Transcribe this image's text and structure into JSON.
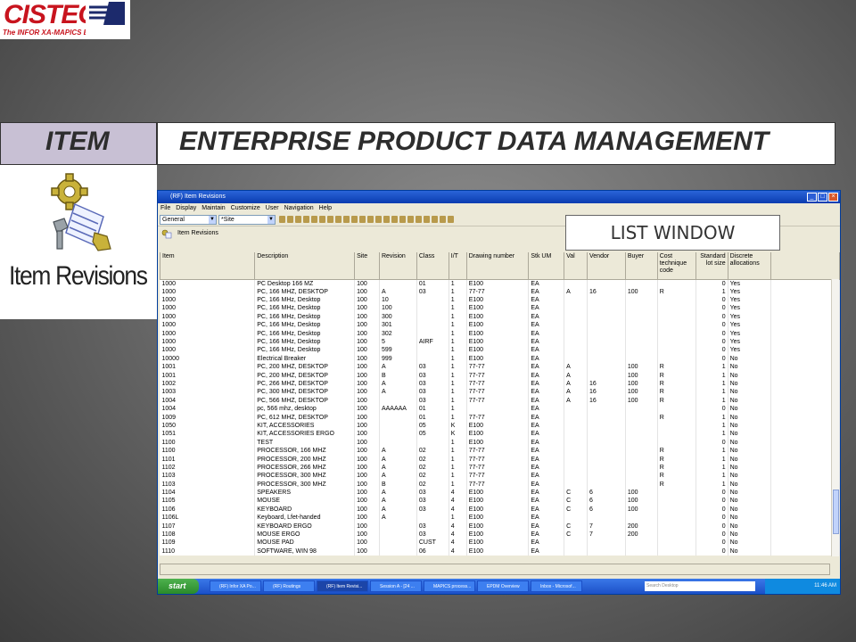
{
  "logo": {
    "word": "CISTECH",
    "tagline": "The INFOR XA-MAPICS Experts"
  },
  "banner": {
    "left": "ITEM",
    "right": "ENTERPRISE PRODUCT DATA MANAGEMENT"
  },
  "icon_panel": {
    "caption": "Item Revisions"
  },
  "callout": "LIST WINDOW",
  "window": {
    "title": "(RF) Item Revisions",
    "menu": [
      "File",
      "Display",
      "Maintain",
      "Customize",
      "User",
      "Navigation",
      "Help"
    ],
    "view_combo": "General",
    "site_combo": "*Site",
    "subheader": "Item Revisions"
  },
  "grid": {
    "columns": [
      "Item",
      "Description",
      "Site",
      "Revision",
      "Class",
      "I/T",
      "Drawing number",
      "Stk UM",
      "Val",
      "Vendor",
      "Buyer",
      "Cost technique code",
      "Standard lot size",
      "Discrete allocations"
    ],
    "rows": [
      [
        "1000",
        "PC Desktop 166 MZ",
        "100",
        "",
        "01",
        "1",
        "E100",
        "EA",
        "",
        "",
        "",
        "",
        "0",
        "Yes"
      ],
      [
        "1000",
        "PC, 166 MHZ, DESKTOP",
        "100",
        "A",
        "03",
        "1",
        "77-77",
        "EA",
        "A",
        "16",
        "100",
        "R",
        "1",
        "Yes"
      ],
      [
        "1000",
        "PC, 166 MHz, Desktop",
        "100",
        "10",
        "",
        "1",
        "E100",
        "EA",
        "",
        "",
        "",
        "",
        "0",
        "Yes"
      ],
      [
        "1000",
        "PC, 166 MHz, Desktop",
        "100",
        "100",
        "",
        "1",
        "E100",
        "EA",
        "",
        "",
        "",
        "",
        "0",
        "Yes"
      ],
      [
        "1000",
        "PC, 166 MHz, Desktop",
        "100",
        "300",
        "",
        "1",
        "E100",
        "EA",
        "",
        "",
        "",
        "",
        "0",
        "Yes"
      ],
      [
        "1000",
        "PC, 166 MHz, Desktop",
        "100",
        "301",
        "",
        "1",
        "E100",
        "EA",
        "",
        "",
        "",
        "",
        "0",
        "Yes"
      ],
      [
        "1000",
        "PC, 166 MHz, Desktop",
        "100",
        "302",
        "",
        "1",
        "E100",
        "EA",
        "",
        "",
        "",
        "",
        "0",
        "Yes"
      ],
      [
        "1000",
        "PC, 166 MHz, Desktop",
        "100",
        "5",
        "AIRF",
        "1",
        "E100",
        "EA",
        "",
        "",
        "",
        "",
        "0",
        "Yes"
      ],
      [
        "1000",
        "PC, 166 MHz, Desktop",
        "100",
        "599",
        "",
        "1",
        "E100",
        "EA",
        "",
        "",
        "",
        "",
        "0",
        "Yes"
      ],
      [
        "10000",
        "Electrical Breaker",
        "100",
        "999",
        "",
        "1",
        "E100",
        "EA",
        "",
        "",
        "",
        "",
        "0",
        "No"
      ],
      [
        "1001",
        "PC, 200 MHZ, DESKTOP",
        "100",
        "A",
        "03",
        "1",
        "77-77",
        "EA",
        "A",
        "",
        "100",
        "R",
        "1",
        "No"
      ],
      [
        "1001",
        "PC, 200 MHZ, DESKTOP",
        "100",
        "B",
        "03",
        "1",
        "77-77",
        "EA",
        "A",
        "",
        "100",
        "R",
        "1",
        "No"
      ],
      [
        "1002",
        "PC, 266 MHZ, DESKTOP",
        "100",
        "A",
        "03",
        "1",
        "77-77",
        "EA",
        "A",
        "16",
        "100",
        "R",
        "1",
        "No"
      ],
      [
        "1003",
        "PC, 300 MHZ, DESKTOP",
        "100",
        "A",
        "03",
        "1",
        "77-77",
        "EA",
        "A",
        "16",
        "100",
        "R",
        "1",
        "No"
      ],
      [
        "1004",
        "PC, 566 MHZ, DESKTOP",
        "100",
        "",
        "03",
        "1",
        "77-77",
        "EA",
        "A",
        "16",
        "100",
        "R",
        "1",
        "No"
      ],
      [
        "1004",
        "pc, 566 mhz, desktop",
        "100",
        "AAAAAA",
        "01",
        "1",
        "",
        "EA",
        "",
        "",
        "",
        "",
        "0",
        "No"
      ],
      [
        "1009",
        "PC, 612 MHZ, DESKTOP",
        "100",
        "",
        "01",
        "1",
        "77-77",
        "EA",
        "",
        "",
        "",
        "R",
        "1",
        "No"
      ],
      [
        "1050",
        "KIT, ACCESSORIES",
        "100",
        "",
        "05",
        "K",
        "E100",
        "EA",
        "",
        "",
        "",
        "",
        "1",
        "No"
      ],
      [
        "1051",
        "KIT, ACCESSORIES ERGO",
        "100",
        "",
        "05",
        "K",
        "E100",
        "EA",
        "",
        "",
        "",
        "",
        "1",
        "No"
      ],
      [
        "1100",
        "TEST",
        "100",
        "",
        "",
        "1",
        "E100",
        "EA",
        "",
        "",
        "",
        "",
        "0",
        "No"
      ],
      [
        "1100",
        "PROCESSOR, 166 MHZ",
        "100",
        "A",
        "02",
        "1",
        "77-77",
        "EA",
        "",
        "",
        "",
        "R",
        "1",
        "No"
      ],
      [
        "1101",
        "PROCESSOR, 200 MHZ",
        "100",
        "A",
        "02",
        "1",
        "77-77",
        "EA",
        "",
        "",
        "",
        "R",
        "1",
        "No"
      ],
      [
        "1102",
        "PROCESSOR, 266 MHZ",
        "100",
        "A",
        "02",
        "1",
        "77-77",
        "EA",
        "",
        "",
        "",
        "R",
        "1",
        "No"
      ],
      [
        "1103",
        "PROCESSOR, 300 MHZ",
        "100",
        "A",
        "02",
        "1",
        "77-77",
        "EA",
        "",
        "",
        "",
        "R",
        "1",
        "No"
      ],
      [
        "1103",
        "PROCESSOR, 300 MHZ",
        "100",
        "B",
        "02",
        "1",
        "77-77",
        "EA",
        "",
        "",
        "",
        "R",
        "1",
        "No"
      ],
      [
        "1104",
        "SPEAKERS",
        "100",
        "A",
        "03",
        "4",
        "E100",
        "EA",
        "C",
        "6",
        "100",
        "",
        "0",
        "No"
      ],
      [
        "1105",
        "MOUSE",
        "100",
        "A",
        "03",
        "4",
        "E100",
        "EA",
        "C",
        "6",
        "100",
        "",
        "0",
        "No"
      ],
      [
        "1106",
        "KEYBOARD",
        "100",
        "A",
        "03",
        "4",
        "E100",
        "EA",
        "C",
        "6",
        "100",
        "",
        "0",
        "No"
      ],
      [
        "1106L",
        "Keyboard, Lfet-handed",
        "100",
        "A",
        "",
        "1",
        "E100",
        "EA",
        "",
        "",
        "",
        "",
        "0",
        "No"
      ],
      [
        "1107",
        "KEYBOARD ERGO",
        "100",
        "",
        "03",
        "4",
        "E100",
        "EA",
        "C",
        "7",
        "200",
        "",
        "0",
        "No"
      ],
      [
        "1108",
        "MOUSE ERGO",
        "100",
        "",
        "03",
        "4",
        "E100",
        "EA",
        "C",
        "7",
        "200",
        "",
        "0",
        "No"
      ],
      [
        "1109",
        "MOUSE PAD",
        "100",
        "",
        "CUST",
        "4",
        "E100",
        "EA",
        "",
        "",
        "",
        "",
        "0",
        "No"
      ],
      [
        "1110",
        "SOFTWARE, WIN 98",
        "100",
        "",
        "06",
        "4",
        "E100",
        "EA",
        "",
        "",
        "",
        "",
        "0",
        "No"
      ]
    ]
  },
  "taskbar": {
    "start": "start",
    "tasks": [
      "(RF) Infor XA Po...",
      "(RF) Routings",
      "(RF) Item Revisi...",
      "Session A - [24 ...",
      "MAPICS process...",
      "EPDM Overview",
      "Inbox - Microsof..."
    ],
    "search_placeholder": "Search Desktop",
    "clock": "11:46 AM"
  }
}
